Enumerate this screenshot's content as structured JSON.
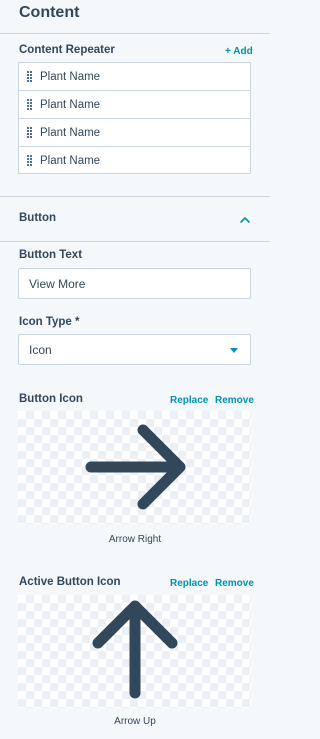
{
  "panel": {
    "title": "Content"
  },
  "repeater": {
    "label": "Content Repeater",
    "add_label": "+ Add",
    "items": [
      {
        "label": "Plant Name"
      },
      {
        "label": "Plant Name"
      },
      {
        "label": "Plant Name"
      },
      {
        "label": "Plant Name"
      }
    ]
  },
  "button_section": {
    "title": "Button",
    "button_text_label": "Button Text",
    "button_text_value": "View More",
    "icon_type_label": "Icon Type *",
    "icon_type_value": "Icon",
    "button_icon": {
      "label": "Button Icon",
      "replace": "Replace",
      "remove": "Remove",
      "icon": "arrow-right-icon",
      "caption": "Arrow Right"
    },
    "active_button_icon": {
      "label": "Active Button Icon",
      "replace": "Replace",
      "remove": "Remove",
      "icon": "arrow-up-icon",
      "caption": "Arrow Up"
    }
  },
  "colors": {
    "text": "#33475b",
    "link": "#0091ae",
    "border": "#cbd6e2",
    "background": "#f5f8fa",
    "icon": "#33475b"
  }
}
